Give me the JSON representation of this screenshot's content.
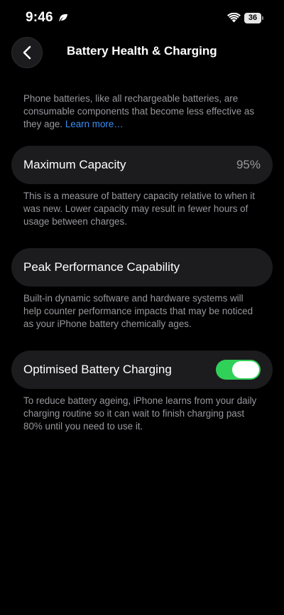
{
  "status_bar": {
    "time": "9:46",
    "battery_level": "36"
  },
  "nav": {
    "title": "Battery Health & Charging"
  },
  "intro": {
    "text": "Phone batteries, like all rechargeable batteries, are consumable components that become less effective as they age.",
    "link_text": "Learn more…"
  },
  "max_capacity": {
    "label": "Maximum Capacity",
    "value": "95%",
    "footnote": "This is a measure of battery capacity relative to when it was new. Lower capacity may result in fewer hours of usage between charges."
  },
  "peak_performance": {
    "label": "Peak Performance Capability",
    "footnote": "Built-in dynamic software and hardware systems will help counter performance impacts that may be noticed as your iPhone battery chemically ages."
  },
  "optimised_charging": {
    "label": "Optimised Battery Charging",
    "enabled": true,
    "footnote": "To reduce battery ageing, iPhone learns from your daily charging routine so it can wait to finish charging past 80% until you need to use it."
  },
  "colors": {
    "background": "#000000",
    "cell": "#1c1c1e",
    "secondary_text": "#98989e",
    "link": "#3a8ef5",
    "toggle_on": "#30d158"
  }
}
